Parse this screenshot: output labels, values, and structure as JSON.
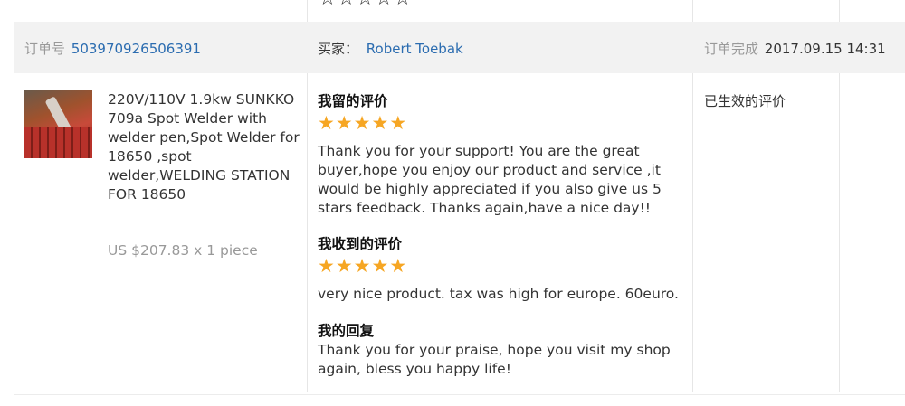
{
  "top_rating": {
    "stars": 5,
    "filled": false
  },
  "header": {
    "order_label": "订单号",
    "order_number": "503970926506391",
    "buyer_label": "买家：",
    "buyer_name": "Robert Toebak",
    "completed_label": "订单完成",
    "completed_time": "2017.09.15 14:31"
  },
  "product": {
    "title": "220V/110V 1.9kw SUNKKO 709a Spot Welder with welder pen,Spot Welder for 18650 ,spot welder,WELDING STATION FOR 18650",
    "price": "US $207.83 x 1 piece"
  },
  "my_review": {
    "label": "我留的评价",
    "rating": 5,
    "text": "Thank you for your support! You are the great buyer,hope you enjoy our product and service ,it would be highly appreciated if you also give us 5 stars feedback. Thanks again,have a nice day!!"
  },
  "received_review": {
    "label": "我收到的评价",
    "rating": 5,
    "text": "very nice product. tax was high for europe. 60euro."
  },
  "my_reply": {
    "label": "我的回复",
    "text": "Thank you for your praise, hope you visit my shop again, bless you happy life!"
  },
  "status": {
    "text": "已生效的评价"
  },
  "colors": {
    "star": "#f6a623",
    "link": "#2b6cb0",
    "header_bg": "#f2f2f2"
  }
}
